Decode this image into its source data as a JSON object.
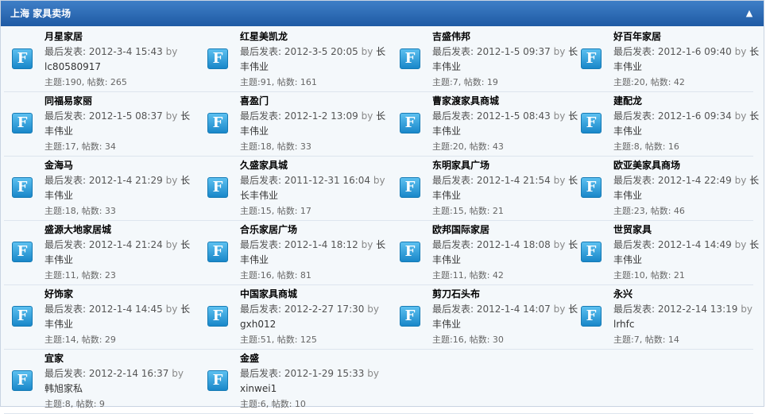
{
  "header": {
    "title": "上海   家具卖场",
    "collapse_icon": "chevron-up-icon"
  },
  "icon_glyph": "F",
  "last_post_label": "最后发表:",
  "by_label": "by",
  "rows": [
    [
      {
        "name": "月星家居",
        "date": "2012-3-4 15:43",
        "user": "lc80580917",
        "stats": "主题:190, 帖数: 265"
      },
      {
        "name": "红星美凯龙",
        "date": "2012-3-5 20:05",
        "user": "长丰伟业",
        "stats": "主题:91, 帖数: 161"
      },
      {
        "name": "吉盛伟邦",
        "date": "2012-1-5 09:37",
        "user": "长丰伟业",
        "stats": "主题:7, 帖数: 19"
      },
      {
        "name": "好百年家居",
        "date": "2012-1-6 09:40",
        "user": "长丰伟业",
        "stats": "主题:20, 帖数: 42"
      }
    ],
    [
      {
        "name": "同福易家丽",
        "date": "2012-1-5 08:37",
        "user": "长丰伟业",
        "stats": "主题:17, 帖数: 34"
      },
      {
        "name": "喜盈门",
        "date": "2012-1-2 13:09",
        "user": "长丰伟业",
        "stats": "主题:18, 帖数: 33"
      },
      {
        "name": "曹家渡家具商城",
        "date": "2012-1-5 08:43",
        "user": "长丰伟业",
        "stats": "主题:20, 帖数: 43"
      },
      {
        "name": "建配龙",
        "date": "2012-1-6 09:34",
        "user": "长丰伟业",
        "stats": "主题:8, 帖数: 16"
      }
    ],
    [
      {
        "name": "金海马",
        "date": "2012-1-4 21:29",
        "user": "长丰伟业",
        "stats": "主题:18, 帖数: 33"
      },
      {
        "name": "久盛家具城",
        "date": "2011-12-31 16:04",
        "user": "长丰伟业",
        "stats": "主题:15, 帖数: 17"
      },
      {
        "name": "东明家具广场",
        "date": "2012-1-4 21:54",
        "user": "长丰伟业",
        "stats": "主题:15, 帖数: 21"
      },
      {
        "name": "欧亚美家具商场",
        "date": "2012-1-4 22:49",
        "user": "长丰伟业",
        "stats": "主题:23, 帖数: 46"
      }
    ],
    [
      {
        "name": "盛源大地家居城",
        "date": "2012-1-4 21:24",
        "user": "长丰伟业",
        "stats": "主题:11, 帖数: 23"
      },
      {
        "name": "合乐家居广场",
        "date": "2012-1-4 18:12",
        "user": "长丰伟业",
        "stats": "主题:16, 帖数: 81"
      },
      {
        "name": "欧邦国际家居",
        "date": "2012-1-4 18:08",
        "user": "长丰伟业",
        "stats": "主题:11, 帖数: 42"
      },
      {
        "name": "世贸家具",
        "date": "2012-1-4 14:49",
        "user": "长丰伟业",
        "stats": "主题:10, 帖数: 21"
      }
    ],
    [
      {
        "name": "好饰家",
        "date": "2012-1-4 14:45",
        "user": "长丰伟业",
        "stats": "主题:14, 帖数: 29"
      },
      {
        "name": "中国家具商城",
        "date": "2012-2-27 17:30",
        "user": "gxh012",
        "stats": "主题:51, 帖数: 125"
      },
      {
        "name": "剪刀石头布",
        "date": "2012-1-4 14:07",
        "user": "长丰伟业",
        "stats": "主题:16, 帖数: 30"
      },
      {
        "name": "永兴",
        "date": "2012-2-14 13:19",
        "user": "lrhfc",
        "stats": "主题:7, 帖数: 14"
      }
    ],
    [
      {
        "name": "宜家",
        "date": "2012-2-14 16:37",
        "user": "韩旭家私",
        "stats": "主题:8, 帖数: 9"
      },
      {
        "name": "金盛",
        "date": "2012-1-29 15:33",
        "user": "xinwei1",
        "stats": "主题:6, 帖数: 10"
      }
    ]
  ]
}
